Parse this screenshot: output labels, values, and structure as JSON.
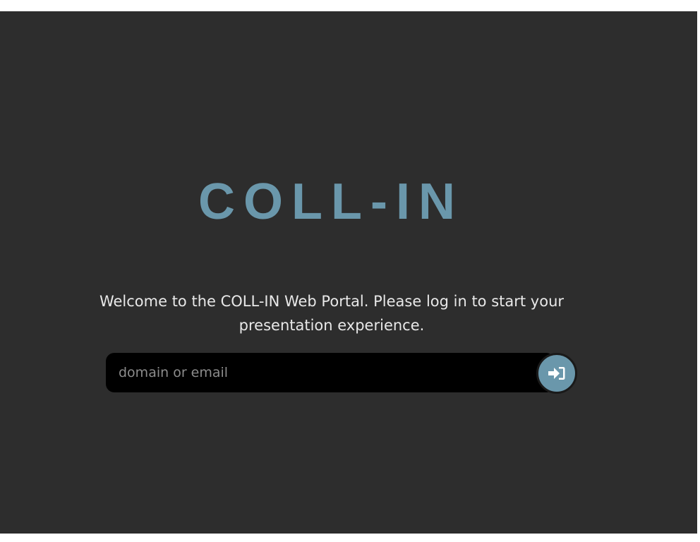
{
  "logo": {
    "text": "COLL-IN"
  },
  "welcome": {
    "line1": "Welcome to the COLL-IN Web Portal. Please log in to start your",
    "line2": "presentation experience."
  },
  "login": {
    "placeholder": "domain or email",
    "value": "",
    "button_icon": "sign-in-icon"
  },
  "colors": {
    "background": "#2d2d2d",
    "accent": "#6a97ab",
    "input_background": "#000000",
    "text": "#e8e8e8"
  }
}
